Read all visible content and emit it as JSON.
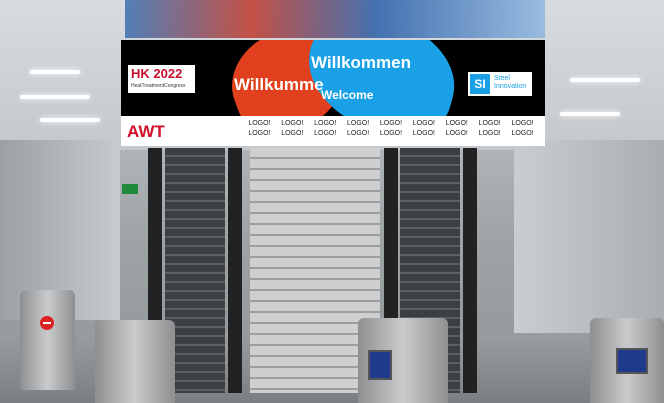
{
  "banner": {
    "event_title": "HK 2022",
    "event_subtitle": "HeatTreatmentCongress",
    "welcome_line1": "Willkommen",
    "welcome_line2": "Willkumme",
    "welcome_line3": "Welcome",
    "si_mark": "SI",
    "si_text_line1": "Steel",
    "si_text_line2": "Innovation",
    "awt_logo": "AWT",
    "logo_placeholder": "LOGO!"
  },
  "colors": {
    "hk_red": "#c8102e",
    "awt_red": "#d0102a",
    "si_blue": "#1aa0e6",
    "banner_black": "#000000"
  }
}
